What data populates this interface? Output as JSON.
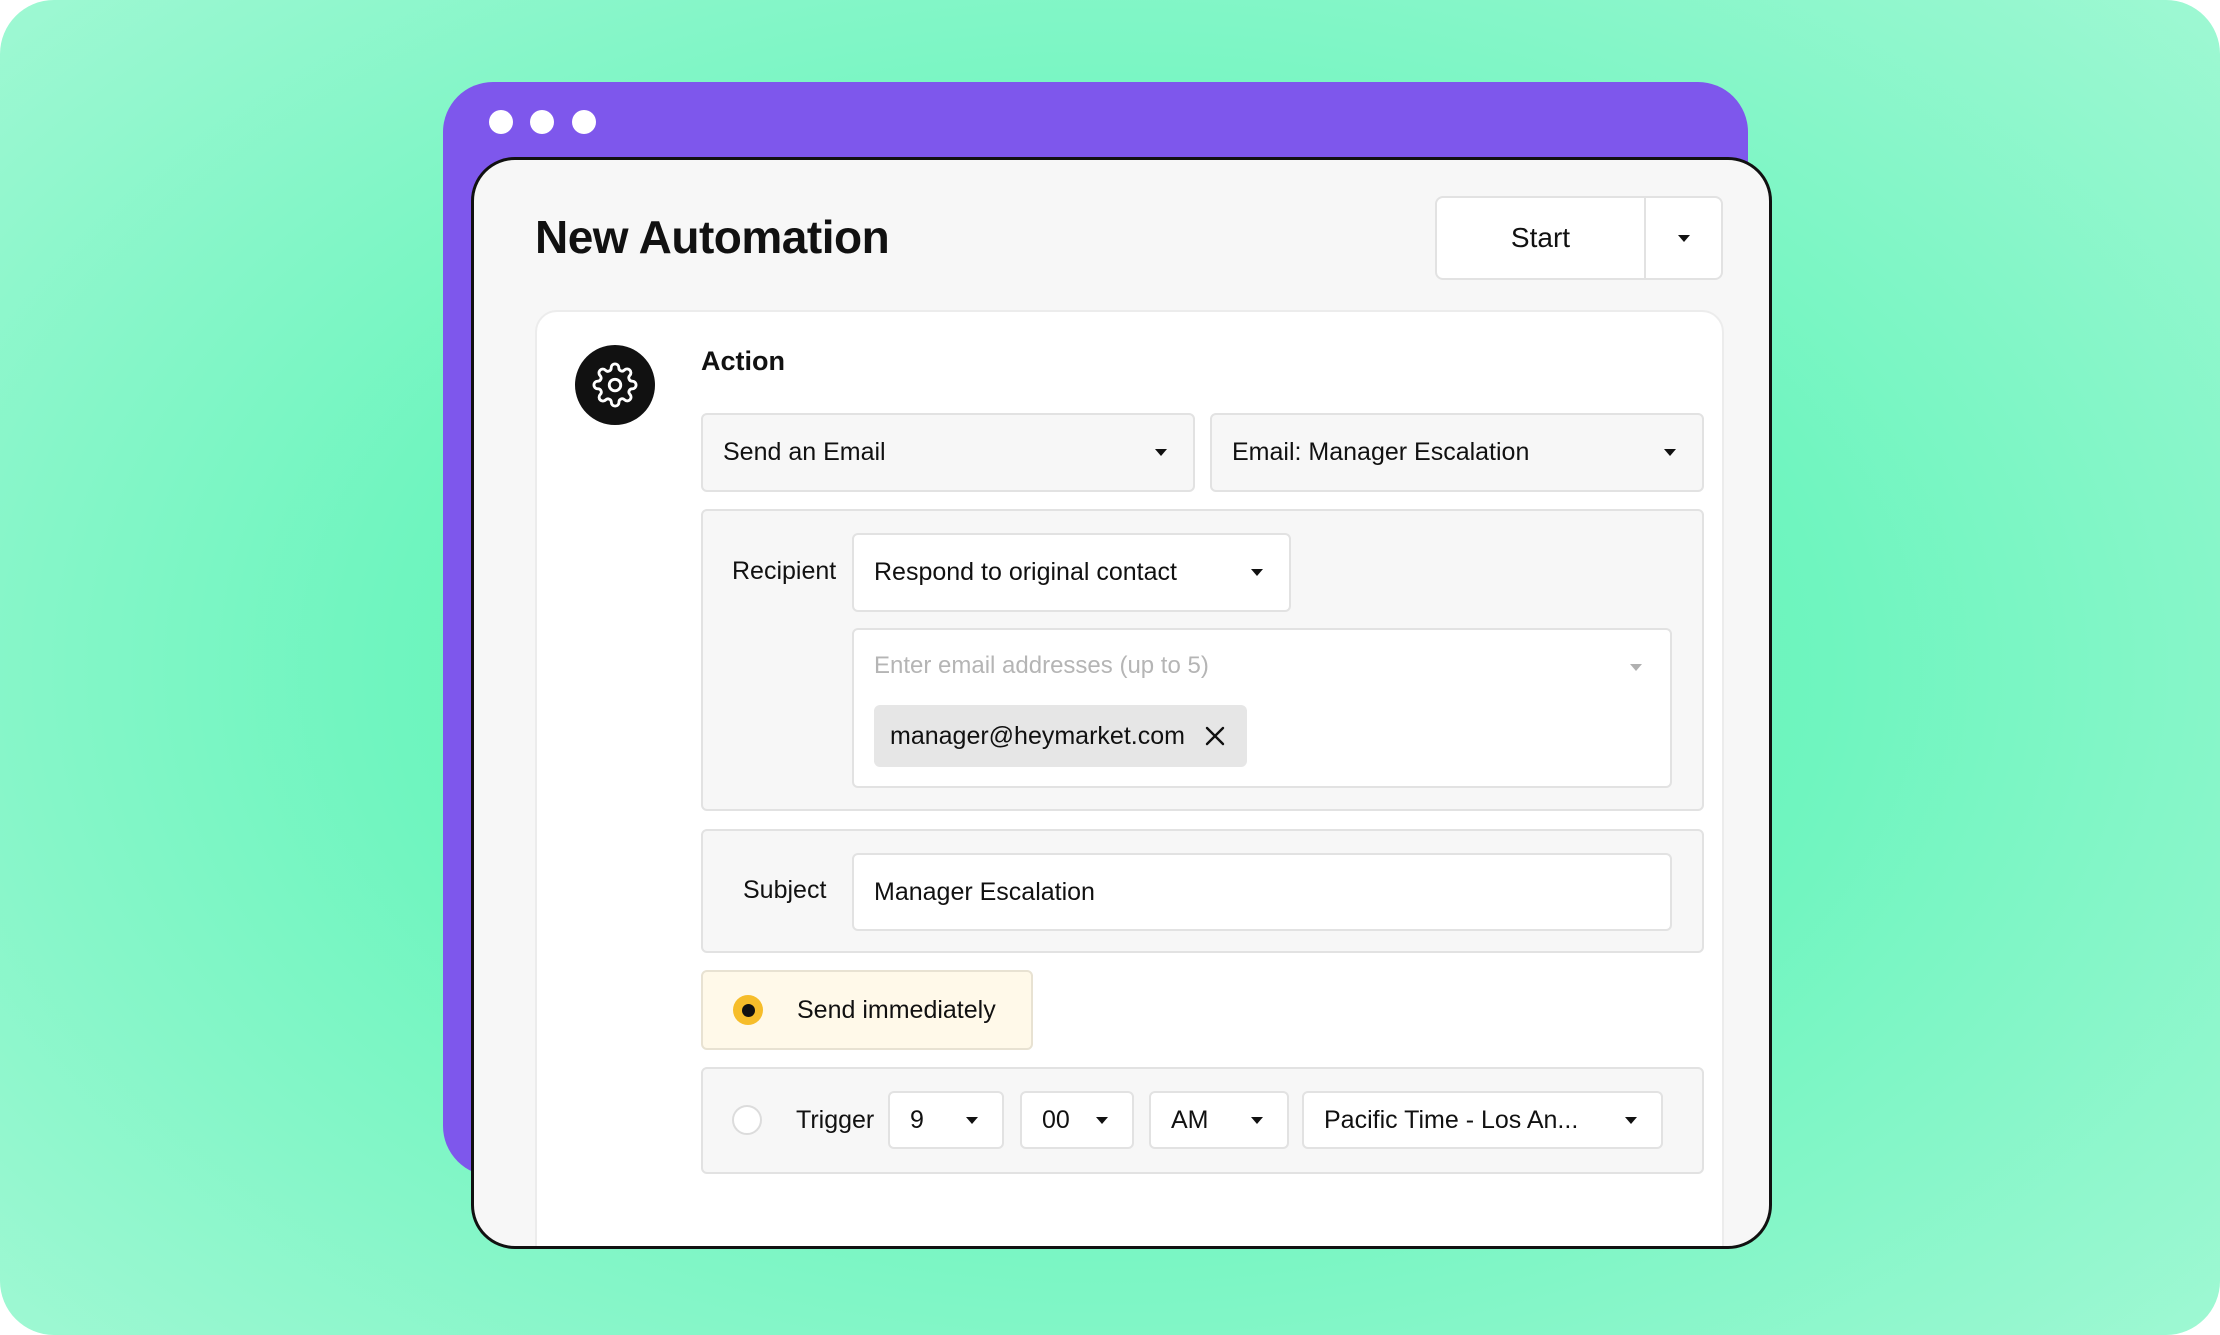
{
  "window": {
    "title": "New Automation",
    "start_label": "Start"
  },
  "action": {
    "heading": "Action",
    "action_type": "Send an Email",
    "template": "Email: Manager Escalation",
    "recipient": {
      "label": "Recipient",
      "mode": "Respond to original contact",
      "placeholder": "Enter email addresses (up to 5)",
      "emails": [
        "manager@heymarket.com"
      ]
    },
    "subject": {
      "label": "Subject",
      "value": "Manager Escalation"
    },
    "send_immediately": {
      "label": "Send immediately",
      "selected": true
    },
    "trigger": {
      "label": "Trigger",
      "selected": false,
      "hour": "9",
      "minute": "00",
      "period": "AM",
      "timezone": "Pacific Time - Los An..."
    }
  },
  "colors": {
    "background": "#6ff5bf",
    "window_accent": "#7e57ec",
    "radio_selected": "#f6bd2a",
    "selected_option_bg": "#fff9e9"
  }
}
